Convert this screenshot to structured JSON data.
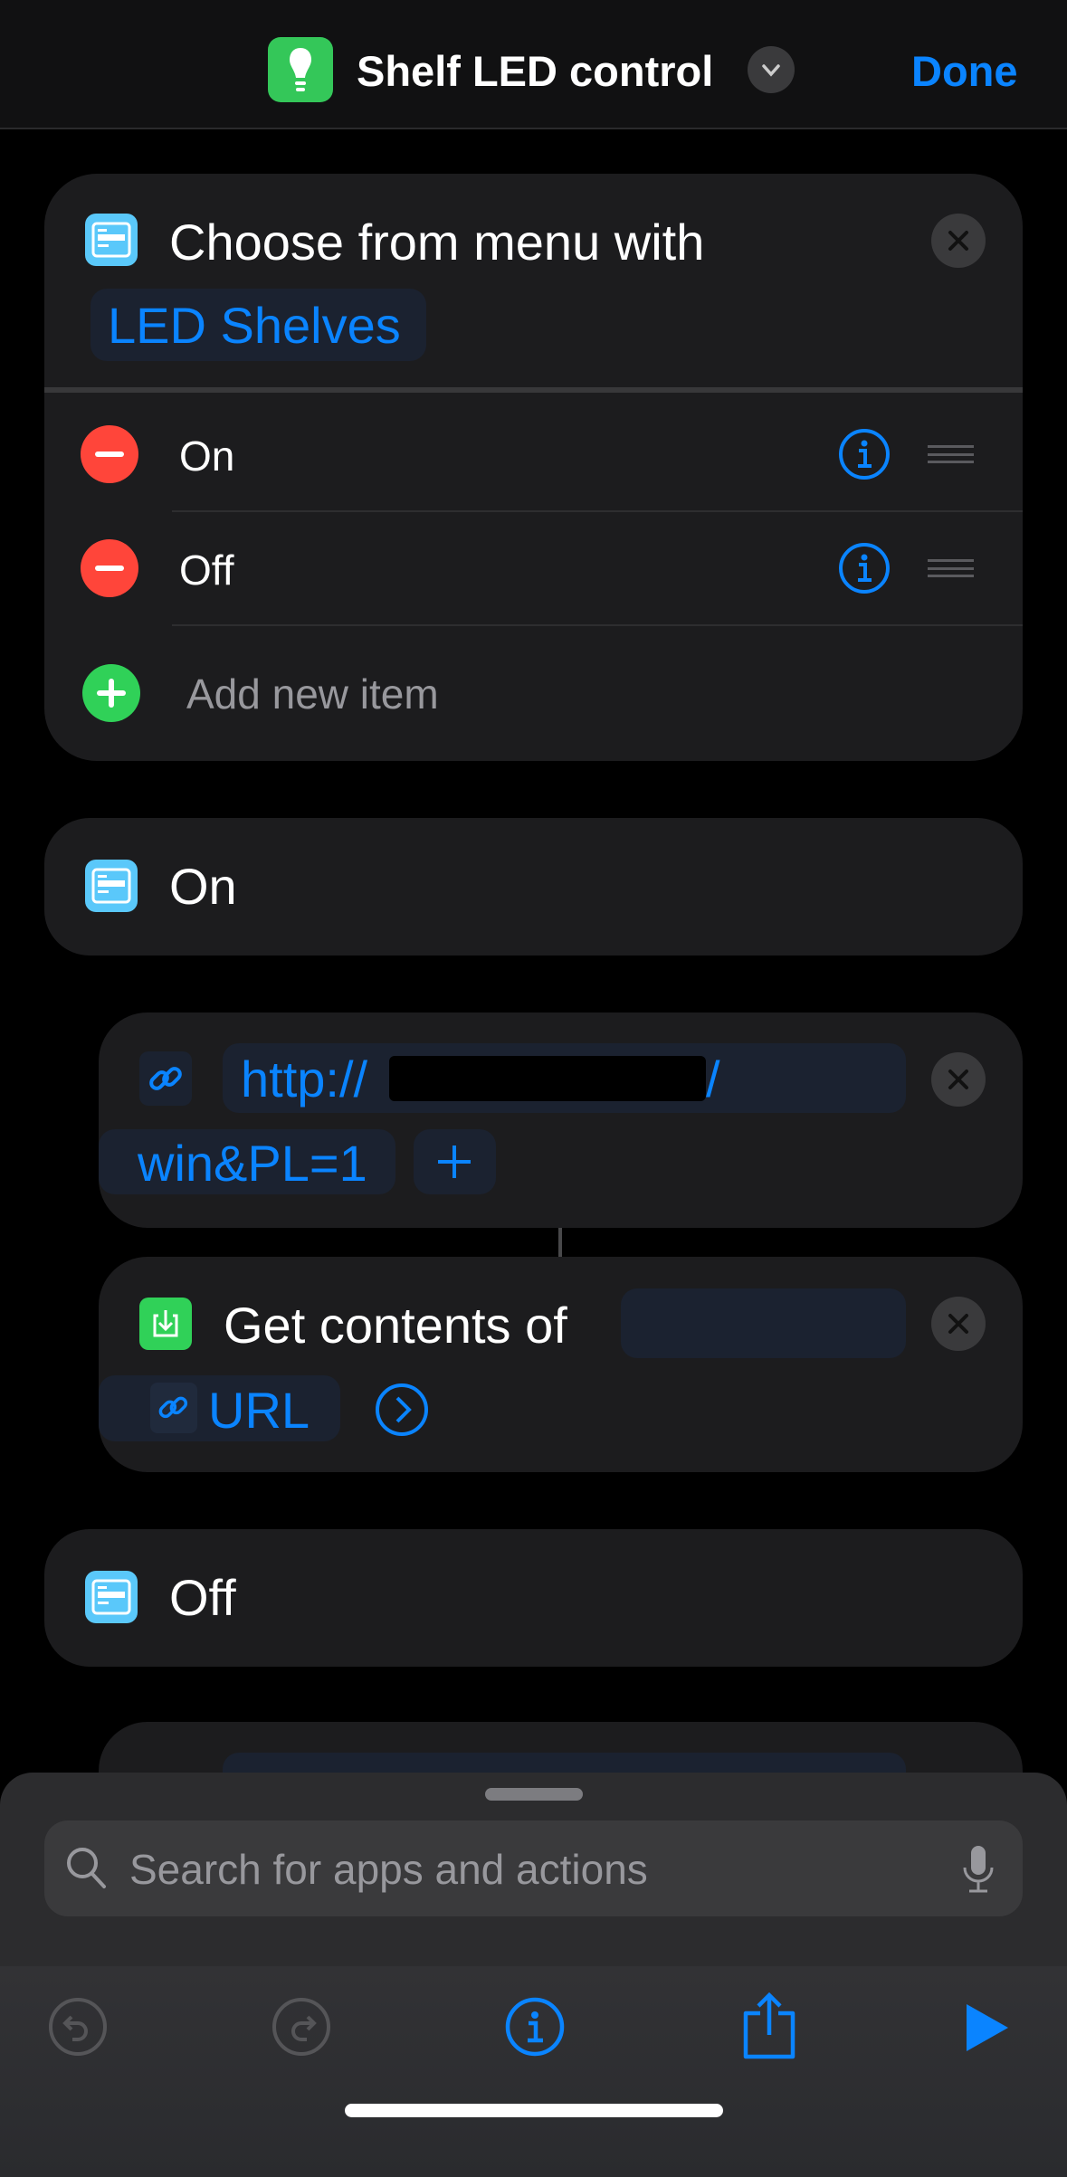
{
  "header": {
    "title": "Shelf LED control",
    "done_label": "Done",
    "app_icon": "lightbulb-icon",
    "accent": "#0a84ff"
  },
  "menu_action": {
    "title": "Choose from menu with",
    "prompt": "LED Shelves",
    "items": [
      {
        "label": "On"
      },
      {
        "label": "Off"
      }
    ],
    "add_item_label": "Add new item"
  },
  "case_on": {
    "label": "On"
  },
  "url_action": {
    "prefix": "http://",
    "suffix": "/",
    "line2": "win&PL=1"
  },
  "get_contents": {
    "title": "Get contents of",
    "param": "URL"
  },
  "case_off": {
    "label": "Off"
  },
  "sheet": {
    "search_placeholder": "Search for apps and actions"
  },
  "toolbar": {
    "icons": [
      "undo-icon",
      "redo-icon",
      "info-icon",
      "share-icon",
      "play-icon"
    ]
  }
}
